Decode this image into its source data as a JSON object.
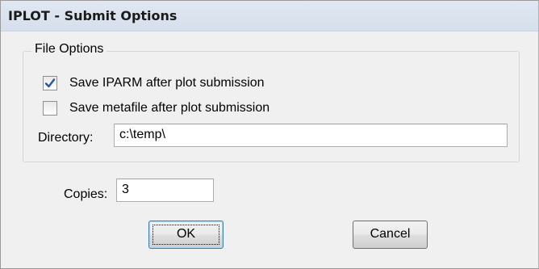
{
  "window": {
    "title": "IPLOT - Submit Options"
  },
  "file_options": {
    "legend": "File Options",
    "save_iparm": {
      "label": "Save IPARM after plot submission",
      "checked": true
    },
    "save_metafile": {
      "label": "Save metafile after plot submission",
      "checked": false
    },
    "directory": {
      "label": "Directory:",
      "value": "c:\\temp\\"
    }
  },
  "copies": {
    "label": "Copies:",
    "value": "3"
  },
  "buttons": {
    "ok": "OK",
    "cancel": "Cancel"
  },
  "colors": {
    "checkmark": "#2a53a7",
    "title_bar": "#dae3ee"
  }
}
